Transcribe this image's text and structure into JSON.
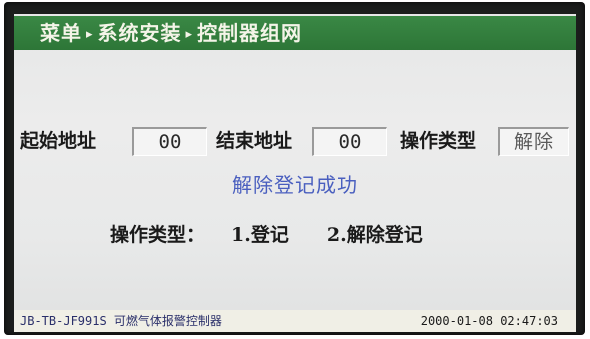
{
  "breadcrumb": {
    "items": [
      "菜单",
      "系统安装",
      "控制器组网"
    ],
    "separator": "▸"
  },
  "form": {
    "start_address_label": "起始地址",
    "start_address_value": "00",
    "end_address_label": "结束地址",
    "end_address_value": "00",
    "operation_type_label": "操作类型",
    "operation_type_value": "解除"
  },
  "status_message": "解除登记成功",
  "hint": {
    "label": "操作类型：",
    "option_1": "1.登记",
    "option_2": "2.解除登记"
  },
  "footer": {
    "device_model": "JB-TB-JF991S 可燃气体报警控制器",
    "datetime": "2000-01-08 02:47:03"
  },
  "colors": {
    "title_bar": "#2f7a3a",
    "status_message": "#4a5fbf",
    "screen_background": "#e8e9e9"
  }
}
